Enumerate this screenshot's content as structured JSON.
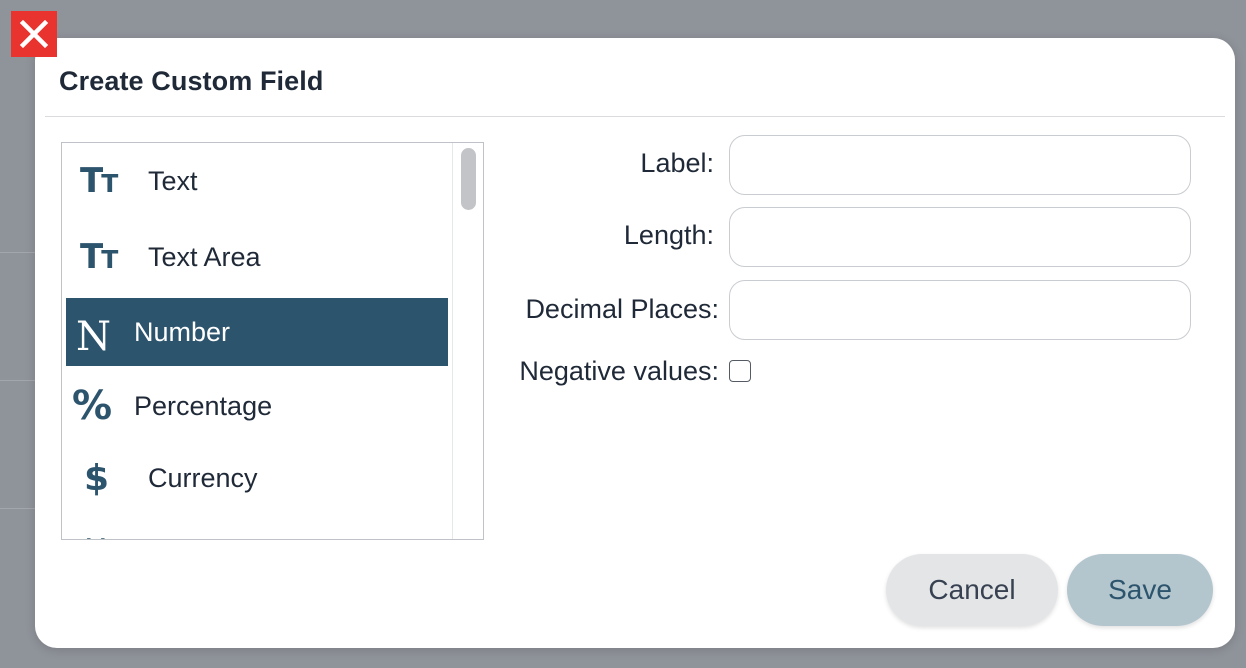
{
  "dialog": {
    "title": "Create Custom Field",
    "close_icon": "close-icon"
  },
  "field_types": [
    {
      "label": "Text",
      "icon": "text-icon",
      "selected": false
    },
    {
      "label": "Text Area",
      "icon": "text-area-icon",
      "selected": false
    },
    {
      "label": "Number",
      "icon": "number-icon",
      "selected": true
    },
    {
      "label": "Percentage",
      "icon": "percentage-icon",
      "selected": false
    },
    {
      "label": "Currency",
      "icon": "currency-icon",
      "selected": false
    }
  ],
  "form": {
    "label_label": "Label:",
    "label_value": "",
    "length_label": "Length:",
    "length_value": "",
    "decimal_places_label": "Decimal Places:",
    "decimal_places_value": "",
    "negative_values_label": "Negative values:",
    "negative_values_checked": false
  },
  "footer": {
    "cancel_label": "Cancel",
    "save_label": "Save"
  },
  "colors": {
    "accent": "#2c546d",
    "close_button": "#e8332f",
    "save_button_bg": "#b3c5cd",
    "cancel_button_bg": "#e4e5e7",
    "overlay": "#8f939a"
  }
}
